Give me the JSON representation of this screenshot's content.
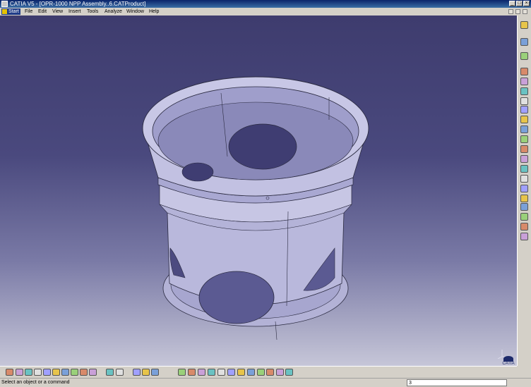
{
  "window": {
    "title": "CATIA V5 - [OPR-1000 NPP Assembly..6.CATProduct]"
  },
  "menu": {
    "start": "Start",
    "items": [
      "File",
      "Edit",
      "View",
      "Insert",
      "Tools",
      "Analyze",
      "Window",
      "Help"
    ]
  },
  "viewport": {
    "background_top": "#3e3c6e",
    "background_bottom": "#c6c6d8",
    "model_fill": "#b9b8d9",
    "model_shade": "#8e8cb6",
    "logo_text": "CATIA"
  },
  "right_toolbar": {
    "icons": [
      "catalog-icon",
      "select-icon",
      "assembly-icon",
      "new-component-icon",
      "new-product-icon",
      "new-part-icon",
      "existing-component-icon",
      "replace-icon",
      "graph-tree-icon",
      "generate-numbering-icon",
      "bill-of-material-icon",
      "reuse-pattern-icon",
      "manipulation-icon",
      "snap-icon",
      "explode-icon",
      "clash-icon",
      "sectioning-icon",
      "measure-icon",
      "quick-constraint-icon",
      "light-bulb-icon",
      "hide-icon"
    ]
  },
  "bottom_toolbar": {
    "icons": [
      "new-file-icon",
      "open-file-icon",
      "save-icon",
      "print-icon",
      "cut-icon",
      "copy-icon",
      "paste-icon",
      "undo-icon",
      "redo-icon",
      "whats-this-icon",
      "formula-icon",
      "comment-icon",
      "material-icon",
      "apply-material-icon",
      "catalog-browser-icon",
      "fly-mode-icon",
      "fit-all-icon",
      "pan-icon",
      "rotate-icon",
      "zoom-in-icon",
      "zoom-out-icon",
      "normal-view-icon",
      "iso-view-icon",
      "shading-icon",
      "hide-show-icon",
      "swap-space-icon",
      "render-icon"
    ]
  },
  "status": {
    "message": "Select an object or a command",
    "command_value": "3"
  }
}
